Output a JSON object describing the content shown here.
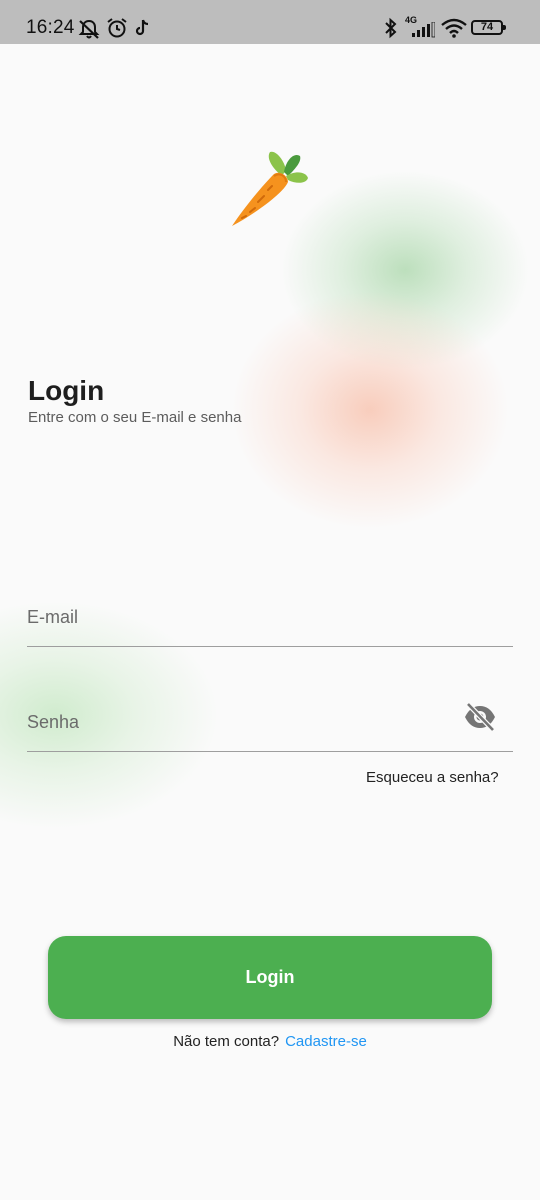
{
  "status_bar": {
    "time": "16:24",
    "network_label": "4G",
    "battery": "74",
    "icons": [
      "mute-icon",
      "alarm-icon",
      "tiktok-icon",
      "bluetooth-icon",
      "signal-icon",
      "wifi-icon",
      "battery-icon"
    ]
  },
  "logo": {
    "icon": "carrot-icon"
  },
  "header": {
    "title": "Login",
    "subtitle": "Entre com o seu E-mail e senha"
  },
  "form": {
    "email_placeholder": "E-mail",
    "email_value": "",
    "password_placeholder": "Senha",
    "password_value": "",
    "password_visibility_icon": "eye-off-icon",
    "forgot_label": "Esqueceu a senha?"
  },
  "actions": {
    "login_label": "Login",
    "no_account_text": "Não tem conta?",
    "signup_label": "Cadastre-se"
  },
  "colors": {
    "primary": "#4caf50",
    "link": "#2196f3",
    "background": "#fafafa",
    "status_bar": "#bdbdbd"
  }
}
